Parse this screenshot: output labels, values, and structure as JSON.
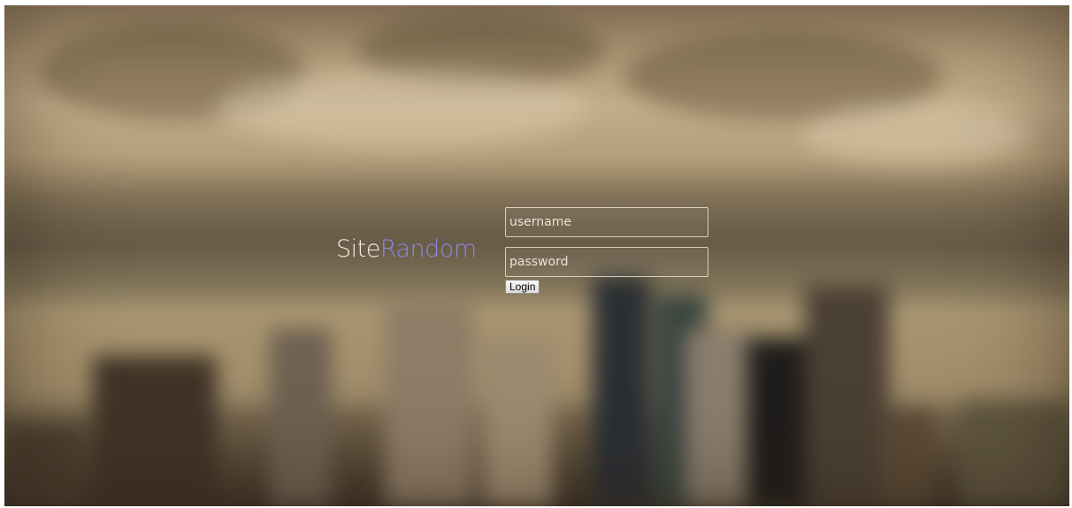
{
  "logo": {
    "part1": "Site",
    "part2": "Random"
  },
  "login_form": {
    "username_placeholder": "username",
    "password_placeholder": "password",
    "login_label": "Login"
  },
  "colors": {
    "logo_site": "#f2ece4",
    "logo_random": "#8e88d8",
    "background_tone": "#a08b6b"
  }
}
